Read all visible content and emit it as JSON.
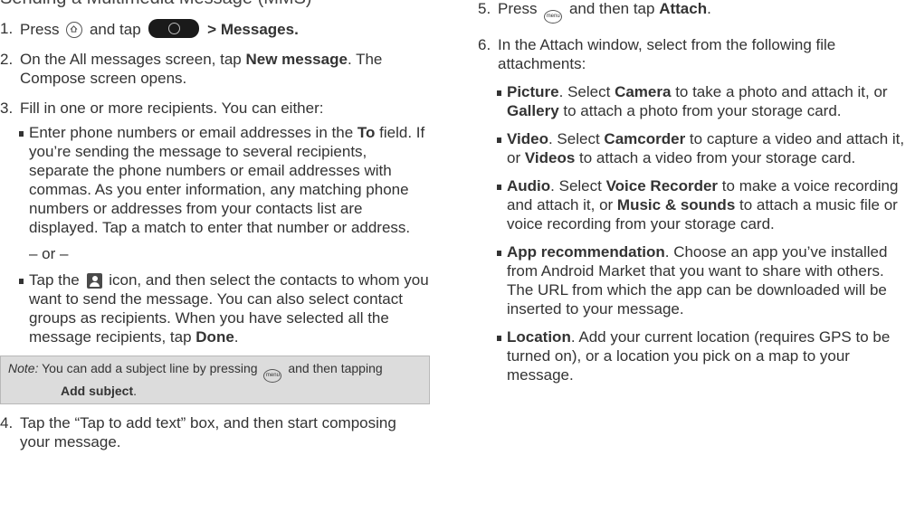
{
  "left": {
    "top_fragment": "Sending a Multimedia Message (MMS)",
    "step1": {
      "num": "1.",
      "pre": "Press",
      "mid": "and tap",
      "arrow": ">",
      "bold": "Messages."
    },
    "step2": {
      "num": "2.",
      "pre": "On the All messages screen, tap",
      "bold": "New message",
      "post": ". The Compose screen opens."
    },
    "step3": {
      "num": "3.",
      "text": "Fill in one or more recipients. You can either:",
      "bullet1": {
        "pre": "Enter phone numbers or email addresses in the",
        "bold": "To",
        "post": "field. If you’re sending the message to several recipients, separate the phone numbers or email addresses with commas. As you enter information, any matching phone numbers or addresses from your contacts list are displayed. Tap a match to enter that number or address."
      },
      "or": "– or –",
      "bullet2": {
        "pre": "Tap the",
        "post": "icon, and then select the contacts to whom you want to send the message. You can also select contact groups as recipients. When you have selected all the message recipients, tap",
        "bold": "Done",
        "end": "."
      }
    },
    "note": {
      "label": "Note:",
      "pre": "You can add a subject line by pressing",
      "mid": "and then tapping",
      "bold": "Add subject",
      "end": "."
    },
    "step4": {
      "num": "4.",
      "text": "Tap the “Tap to add text” box, and then start composing your message."
    }
  },
  "right": {
    "step5": {
      "num": "5.",
      "pre": "Press",
      "mid": "and then tap",
      "bold": "Attach",
      "end": "."
    },
    "step6": {
      "num": "6.",
      "text": "In the Attach window, select from the following file attachments:",
      "items": [
        {
          "b1": "Picture",
          "t1": ". Select",
          "b2": "Camera",
          "t2": "to take a photo and attach it, or",
          "b3": "Gallery",
          "t3": "to attach a photo from your storage card."
        },
        {
          "b1": "Video",
          "t1": ". Select",
          "b2": "Camcorder",
          "t2": "to capture a video and attach it, or",
          "b3": "Videos",
          "t3": "to attach a video from your storage card."
        },
        {
          "b1": "Audio",
          "t1": ". Select",
          "b2": "Voice Recorder",
          "t2": "to make a voice recording and attach it, or",
          "b3": "Music & sounds",
          "t3": "to attach a music file or voice recording from your storage card."
        },
        {
          "b1": "App recommendation",
          "t1": ". Choose an app you’ve installed from Android Market that you want to share with others. The URL from which the app can be downloaded will be inserted to your message."
        },
        {
          "b1": "Location",
          "t1": ". Add your current location (requires GPS to be turned on), or a location you pick on a map to your message."
        }
      ]
    }
  },
  "icons": {
    "home": "home-icon",
    "app": "all-apps-icon",
    "menu": "menu-key-icon",
    "contact": "contact-icon",
    "menu_label": "menu"
  }
}
